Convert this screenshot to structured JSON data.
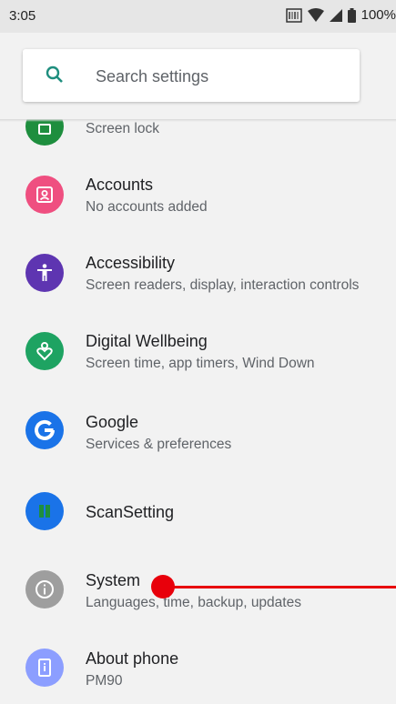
{
  "status_bar": {
    "time": "3:05",
    "battery": "100%"
  },
  "search": {
    "placeholder": "Search settings"
  },
  "items": [
    {
      "title": "",
      "subtitle": "Screen lock",
      "color": "#1e8e3e",
      "icon": "lock-icon"
    },
    {
      "title": "Accounts",
      "subtitle": "No accounts added",
      "color": "#ef4f80",
      "icon": "account-box-icon"
    },
    {
      "title": "Accessibility",
      "subtitle": "Screen readers, display, interaction controls",
      "color": "#5e35b1",
      "icon": "accessibility-icon"
    },
    {
      "title": "Digital Wellbeing",
      "subtitle": "Screen time, app timers, Wind Down",
      "color": "#1ea362",
      "icon": "wellbeing-heart-icon"
    },
    {
      "title": "Google",
      "subtitle": "Services & preferences",
      "color": "#1a73e8",
      "icon": "google-g-icon"
    },
    {
      "title": "ScanSetting",
      "subtitle": "",
      "color": "#1a73e8",
      "icon": "scan-setting-icon"
    },
    {
      "title": "System",
      "subtitle": "Languages, time, backup, updates",
      "color": "#9e9e9e",
      "icon": "info-icon"
    },
    {
      "title": "About phone",
      "subtitle": "PM90",
      "color": "#8c9eff",
      "icon": "phone-info-icon"
    }
  ]
}
